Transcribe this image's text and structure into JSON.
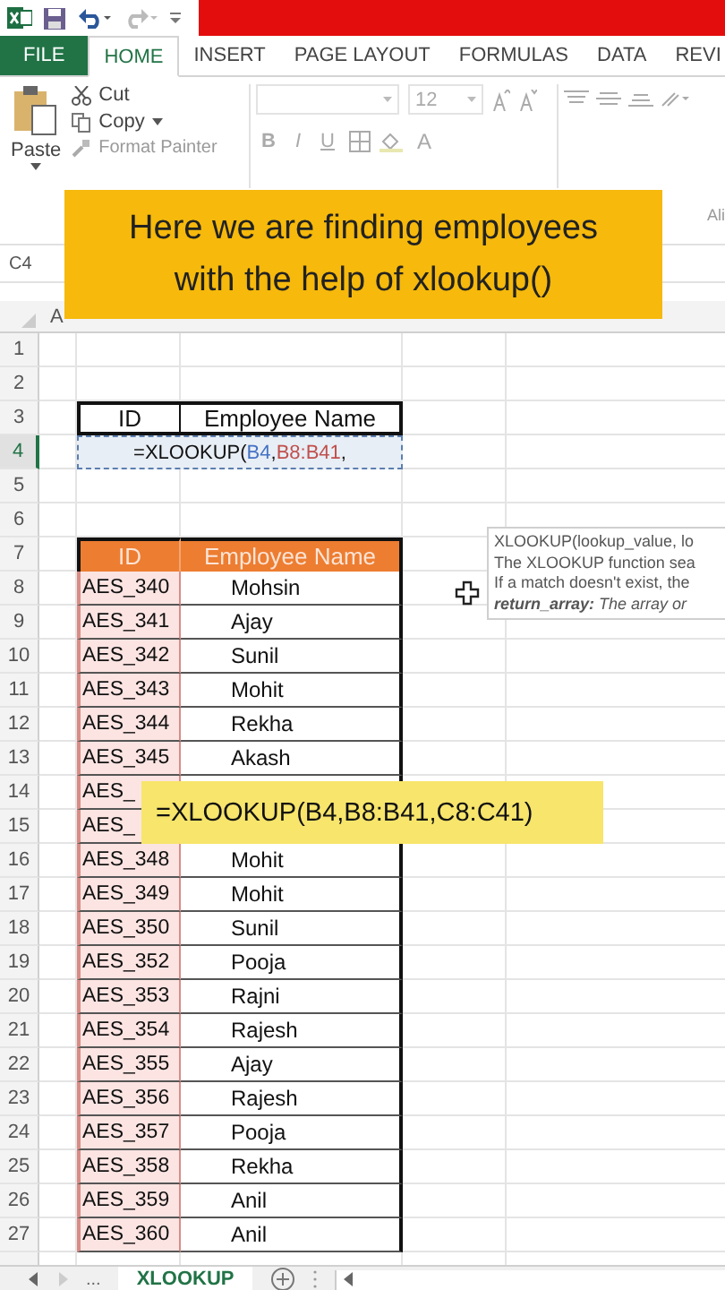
{
  "ribbon_tabs": [
    {
      "label": "FILE",
      "kind": "file",
      "selected": false
    },
    {
      "label": "HOME",
      "kind": "tab",
      "selected": true
    },
    {
      "label": "INSERT",
      "kind": "tab",
      "selected": false
    },
    {
      "label": "PAGE LAYOUT",
      "kind": "tab",
      "selected": false
    },
    {
      "label": "FORMULAS",
      "kind": "tab",
      "selected": false
    },
    {
      "label": "DATA",
      "kind": "tab",
      "selected": false
    },
    {
      "label": "REVI",
      "kind": "tab",
      "selected": false
    }
  ],
  "clipboard": {
    "paste": "Paste",
    "cut": "Cut",
    "copy": "Copy",
    "format_painter": "Format Painter"
  },
  "font": {
    "size": "12",
    "bold": "B",
    "italic": "I",
    "underline": "U",
    "font_color": "A"
  },
  "alignment_group_label": "Ali",
  "banner": "Here we are finding employees with the help of xlookup()",
  "name_box": "C4",
  "column_header": "A",
  "row_numbers": [
    {
      "label": "1",
      "selected": false
    },
    {
      "label": "2",
      "selected": false
    },
    {
      "label": "3",
      "selected": false
    },
    {
      "label": "4",
      "selected": true
    },
    {
      "label": "5",
      "selected": false
    },
    {
      "label": "6",
      "selected": false
    },
    {
      "label": "7",
      "selected": false
    },
    {
      "label": "8",
      "selected": false
    },
    {
      "label": "9",
      "selected": false
    },
    {
      "label": "10",
      "selected": false
    },
    {
      "label": "11",
      "selected": false
    },
    {
      "label": "12",
      "selected": false
    },
    {
      "label": "13",
      "selected": false
    },
    {
      "label": "14",
      "selected": false
    },
    {
      "label": "15",
      "selected": false
    },
    {
      "label": "16",
      "selected": false
    },
    {
      "label": "17",
      "selected": false
    },
    {
      "label": "18",
      "selected": false
    },
    {
      "label": "19",
      "selected": false
    },
    {
      "label": "20",
      "selected": false
    },
    {
      "label": "21",
      "selected": false
    },
    {
      "label": "22",
      "selected": false
    },
    {
      "label": "23",
      "selected": false
    },
    {
      "label": "24",
      "selected": false
    },
    {
      "label": "25",
      "selected": false
    },
    {
      "label": "26",
      "selected": false
    },
    {
      "label": "27",
      "selected": false
    }
  ],
  "lookup_table": {
    "headers": [
      "ID",
      "Employee Name"
    ],
    "formula": [
      {
        "text": "=XLOOKUP("
      },
      {
        "text": "B4",
        "color": "#4472c4"
      },
      {
        "text": ","
      },
      {
        "text": "B8:B41",
        "color": "#c0504d"
      },
      {
        "text": ","
      }
    ]
  },
  "data_table": {
    "headers": [
      "ID",
      "Employee Name"
    ],
    "rows": [
      {
        "id": "AES_340",
        "name": "Mohsin"
      },
      {
        "id": "AES_341",
        "name": "Ajay"
      },
      {
        "id": "AES_342",
        "name": "Sunil"
      },
      {
        "id": "AES_343",
        "name": "Mohit"
      },
      {
        "id": "AES_344",
        "name": "Rekha"
      },
      {
        "id": "AES_345",
        "name": "Akash"
      },
      {
        "id": "AES_"
      },
      {
        "id": "AES_"
      },
      {
        "id": "AES_348",
        "name": "Mohit"
      },
      {
        "id": "AES_349",
        "name": "Mohit"
      },
      {
        "id": "AES_350",
        "name": "Sunil"
      },
      {
        "id": "AES_352",
        "name": "Pooja"
      },
      {
        "id": "AES_353",
        "name": "Rajni"
      },
      {
        "id": "AES_354",
        "name": "Rajesh"
      },
      {
        "id": "AES_355",
        "name": "Ajay"
      },
      {
        "id": "AES_356",
        "name": "Rajesh"
      },
      {
        "id": "AES_357",
        "name": "Pooja"
      },
      {
        "id": "AES_358",
        "name": "Rekha"
      },
      {
        "id": "AES_359",
        "name": "Anil"
      },
      {
        "id": "AES_360",
        "name": "Anil"
      }
    ]
  },
  "tooltip": [
    "XLOOKUP(lookup_value, lo",
    "The XLOOKUP function sea",
    "If a match doesn't exist, the",
    "**return_array:** The array or"
  ],
  "formula_callout": "=XLOOKUP(B4,B8:B41,C8:C41)",
  "sheet_tabs": {
    "more": "...",
    "tabs": [
      {
        "label": "XLOOKUP",
        "selected": true
      }
    ]
  }
}
